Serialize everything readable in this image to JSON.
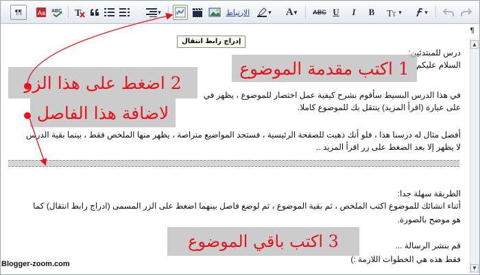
{
  "toolbar": {
    "pilcrow_label": "¶¶",
    "link_label": "الارتباط",
    "bold": "B",
    "italic": "I",
    "underline": "U",
    "abc": "ABC",
    "font_label": "A"
  },
  "tooltip": "إدراج رابط انتقال",
  "editor": {
    "rtl_mark": "¶",
    "lines": [
      "درس للمبتدئين:",
      "السلام عليكم",
      "في هذا الدرس البسيط سأقوم بشرح كيفية عمل اختصار للموضوع ، يظهر في",
      "على عبارة (اقرأ المزيد) ينتقل بك للموضوع كاملا.",
      "أفضل مثال له درسنا هذا ، فلو أنك ذهبت للصفحة الرئيسية ، فستجد المواضيع متراصة ، يظهر منها الملخص فقط ، بينما بقية الدرس",
      "لا يظهر إلا بعد  الضغط على زر اقرأ المزيد ..",
      "الطريقة سهلة جدا:",
      "أثناء انشائك للموضوع اكتب الملخص ، ثم بقية الموضوع ، ثم لوضع فاصل بينهما اضغط على الزر المسمى (ادراج رابط انتقال) كما",
      "هو موضح بالصورة.",
      "قم بنشر الرسالة ...",
      "فقط هذه هي الخطوات اللازمة :)"
    ]
  },
  "annotations": {
    "step1": "1  اكتب مقدمة الموضوع",
    "step2a": "2  اضغط على هذا الزر",
    "step2b": "لاضافة هذا الفاصل",
    "step3": "3  اكتب باقي الموضوع",
    "color": "#e8121a"
  },
  "watermark": "Blogger-zoom.com"
}
